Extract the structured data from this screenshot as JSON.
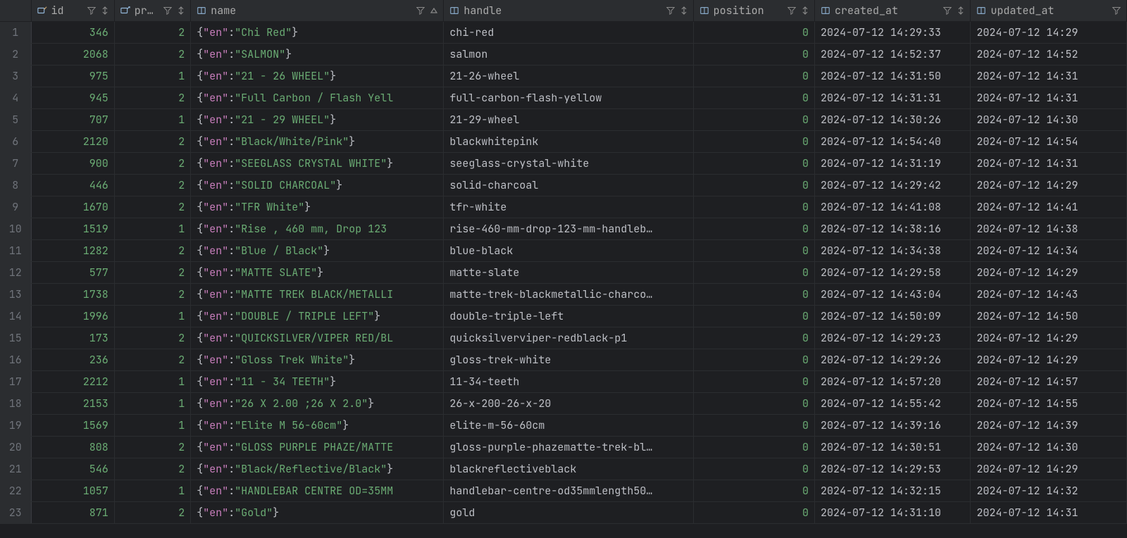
{
  "columns": {
    "id": {
      "label": "id"
    },
    "pro": {
      "label": "pr…"
    },
    "name": {
      "label": "name"
    },
    "handle": {
      "label": "handle"
    },
    "position": {
      "label": "position"
    },
    "created": {
      "label": "created_at"
    },
    "updated": {
      "label": "updated_at"
    }
  },
  "name_json": {
    "key": "\"en\""
  },
  "rows": [
    {
      "n": "1",
      "id": "346",
      "pro": "2",
      "name_val": "\"Chi Red\"",
      "name_suffix": "}",
      "handle": "chi-red",
      "pos": "0",
      "created": "2024-07-12 14:29:33",
      "updated": "2024-07-12 14:29"
    },
    {
      "n": "2",
      "id": "2068",
      "pro": "2",
      "name_val": "\"SALMON\"",
      "name_suffix": "}",
      "handle": "salmon",
      "pos": "0",
      "created": "2024-07-12 14:52:37",
      "updated": "2024-07-12 14:52"
    },
    {
      "n": "3",
      "id": "975",
      "pro": "1",
      "name_val": "\"21 - 26 WHEEL\"",
      "name_suffix": "}",
      "handle": "21-26-wheel",
      "pos": "0",
      "created": "2024-07-12 14:31:50",
      "updated": "2024-07-12 14:31"
    },
    {
      "n": "4",
      "id": "945",
      "pro": "2",
      "name_val": "\"Full Carbon / Flash Yell",
      "name_suffix": "",
      "handle": "full-carbon-flash-yellow",
      "pos": "0",
      "created": "2024-07-12 14:31:31",
      "updated": "2024-07-12 14:31"
    },
    {
      "n": "5",
      "id": "707",
      "pro": "1",
      "name_val": "\"21 - 29 WHEEL\"",
      "name_suffix": "}",
      "handle": "21-29-wheel",
      "pos": "0",
      "created": "2024-07-12 14:30:26",
      "updated": "2024-07-12 14:30"
    },
    {
      "n": "6",
      "id": "2120",
      "pro": "2",
      "name_val": "\"Black/White/Pink\"",
      "name_suffix": "}",
      "handle": "blackwhitepink",
      "pos": "0",
      "created": "2024-07-12 14:54:40",
      "updated": "2024-07-12 14:54"
    },
    {
      "n": "7",
      "id": "900",
      "pro": "2",
      "name_val": "\"SEEGLASS CRYSTAL WHITE\"",
      "name_suffix": "}",
      "handle": "seeglass-crystal-white",
      "pos": "0",
      "created": "2024-07-12 14:31:19",
      "updated": "2024-07-12 14:31"
    },
    {
      "n": "8",
      "id": "446",
      "pro": "2",
      "name_val": "\"SOLID CHARCOAL\"",
      "name_suffix": "}",
      "handle": "solid-charcoal",
      "pos": "0",
      "created": "2024-07-12 14:29:42",
      "updated": "2024-07-12 14:29"
    },
    {
      "n": "9",
      "id": "1670",
      "pro": "2",
      "name_val": "\"TFR White\"",
      "name_suffix": "}",
      "handle": "tfr-white",
      "pos": "0",
      "created": "2024-07-12 14:41:08",
      "updated": "2024-07-12 14:41"
    },
    {
      "n": "10",
      "id": "1519",
      "pro": "1",
      "name_val": "\"Rise , 460 mm, Drop 123",
      "name_suffix": "",
      "handle": "rise-460-mm-drop-123-mm-handleb…",
      "pos": "0",
      "created": "2024-07-12 14:38:16",
      "updated": "2024-07-12 14:38"
    },
    {
      "n": "11",
      "id": "1282",
      "pro": "2",
      "name_val": "\"Blue / Black\"",
      "name_suffix": "}",
      "handle": "blue-black",
      "pos": "0",
      "created": "2024-07-12 14:34:38",
      "updated": "2024-07-12 14:34"
    },
    {
      "n": "12",
      "id": "577",
      "pro": "2",
      "name_val": "\"MATTE SLATE\"",
      "name_suffix": "}",
      "handle": "matte-slate",
      "pos": "0",
      "created": "2024-07-12 14:29:58",
      "updated": "2024-07-12 14:29"
    },
    {
      "n": "13",
      "id": "1738",
      "pro": "2",
      "name_val": "\"MATTE TREK BLACK/METALLI",
      "name_suffix": "",
      "handle": "matte-trek-blackmetallic-charco…",
      "pos": "0",
      "created": "2024-07-12 14:43:04",
      "updated": "2024-07-12 14:43"
    },
    {
      "n": "14",
      "id": "1996",
      "pro": "1",
      "name_val": "\"DOUBLE / TRIPLE LEFT\"",
      "name_suffix": "}",
      "handle": "double-triple-left",
      "pos": "0",
      "created": "2024-07-12 14:50:09",
      "updated": "2024-07-12 14:50"
    },
    {
      "n": "15",
      "id": "173",
      "pro": "2",
      "name_val": "\"QUICKSILVER/VIPER RED/BL",
      "name_suffix": "",
      "handle": "quicksilverviper-redblack-p1",
      "pos": "0",
      "created": "2024-07-12 14:29:23",
      "updated": "2024-07-12 14:29"
    },
    {
      "n": "16",
      "id": "236",
      "pro": "2",
      "name_val": "\"Gloss Trek White\"",
      "name_suffix": "}",
      "handle": "gloss-trek-white",
      "pos": "0",
      "created": "2024-07-12 14:29:26",
      "updated": "2024-07-12 14:29"
    },
    {
      "n": "17",
      "id": "2212",
      "pro": "1",
      "name_val": "\"11 - 34 TEETH\"",
      "name_suffix": "}",
      "handle": "11-34-teeth",
      "pos": "0",
      "created": "2024-07-12 14:57:20",
      "updated": "2024-07-12 14:57"
    },
    {
      "n": "18",
      "id": "2153",
      "pro": "1",
      "name_val": "\"26 X 2.00 ;26 X 2.0\"",
      "name_suffix": "}",
      "handle": "26-x-200-26-x-20",
      "pos": "0",
      "created": "2024-07-12 14:55:42",
      "updated": "2024-07-12 14:55"
    },
    {
      "n": "19",
      "id": "1569",
      "pro": "1",
      "name_val": "\"Elite M 56-60cm\"",
      "name_suffix": "}",
      "handle": "elite-m-56-60cm",
      "pos": "0",
      "created": "2024-07-12 14:39:16",
      "updated": "2024-07-12 14:39"
    },
    {
      "n": "20",
      "id": "808",
      "pro": "2",
      "name_val": "\"GLOSS PURPLE PHAZE/MATTE",
      "name_suffix": "",
      "handle": "gloss-purple-phazematte-trek-bl…",
      "pos": "0",
      "created": "2024-07-12 14:30:51",
      "updated": "2024-07-12 14:30"
    },
    {
      "n": "21",
      "id": "546",
      "pro": "2",
      "name_val": "\"Black/Reflective/Black\"",
      "name_suffix": "}",
      "handle": "blackreflectiveblack",
      "pos": "0",
      "created": "2024-07-12 14:29:53",
      "updated": "2024-07-12 14:29"
    },
    {
      "n": "22",
      "id": "1057",
      "pro": "1",
      "name_val": "\"HANDLEBAR CENTRE OD=35MM",
      "name_suffix": "",
      "handle": "handlebar-centre-od35mmlength50…",
      "pos": "0",
      "created": "2024-07-12 14:32:15",
      "updated": "2024-07-12 14:32"
    },
    {
      "n": "23",
      "id": "871",
      "pro": "2",
      "name_val": "\"Gold\"",
      "name_suffix": "}",
      "handle": "gold",
      "pos": "0",
      "created": "2024-07-12 14:31:10",
      "updated": "2024-07-12 14:31"
    }
  ]
}
